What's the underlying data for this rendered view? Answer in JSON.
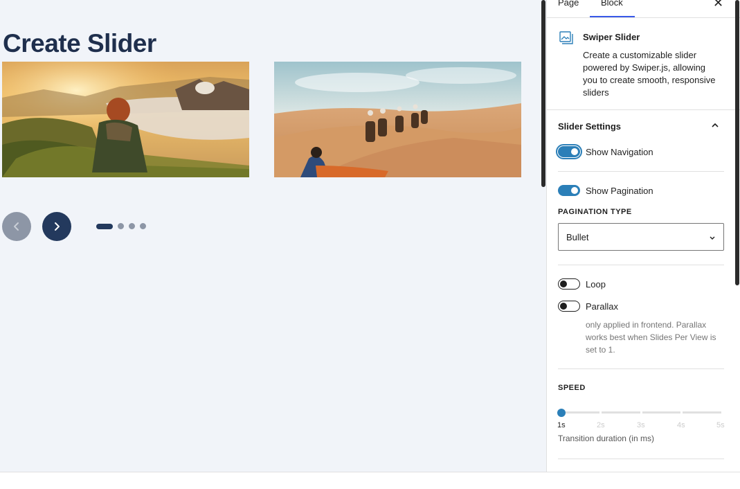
{
  "editor": {
    "title": "Create Slider",
    "slides": [
      {
        "description": "Hiker overlooking misty volcanic valley at sunrise"
      },
      {
        "description": "Camel caravan crossing desert dunes"
      }
    ],
    "pagination_dots": 4,
    "active_dot": 1
  },
  "sidebar": {
    "tabs": [
      {
        "label": "Page"
      },
      {
        "label": "Block"
      }
    ],
    "active_tab": "Block",
    "close_icon": "close-icon",
    "block": {
      "icon": "slider-icon",
      "name": "Swiper Slider",
      "description": "Create a customizable slider powered by Swiper.js, allowing you to create smooth, responsive sliders"
    },
    "panel": {
      "title": "Slider Settings",
      "expanded": true,
      "show_navigation": {
        "label": "Show Navigation",
        "checked": true
      },
      "show_pagination": {
        "label": "Show Pagination",
        "checked": true
      },
      "pagination_type": {
        "label": "PAGINATION TYPE",
        "value": "Bullet"
      },
      "loop": {
        "label": "Loop",
        "checked": false
      },
      "parallax": {
        "label": "Parallax",
        "checked": false,
        "help": "only applied in frontend. Parallax works best when Slides Per View is set to 1."
      },
      "speed": {
        "label": "SPEED",
        "value": "1s",
        "marks": [
          "1s",
          "2s",
          "3s",
          "4s",
          "5s"
        ],
        "help": "Transition duration (in ms)"
      }
    }
  },
  "colors": {
    "accent": "#2b7fb8",
    "title": "#1f2f4d",
    "nav_active": "#23395d",
    "nav_inactive": "#8d96a6",
    "canvas_bg": "#f1f4f9"
  }
}
